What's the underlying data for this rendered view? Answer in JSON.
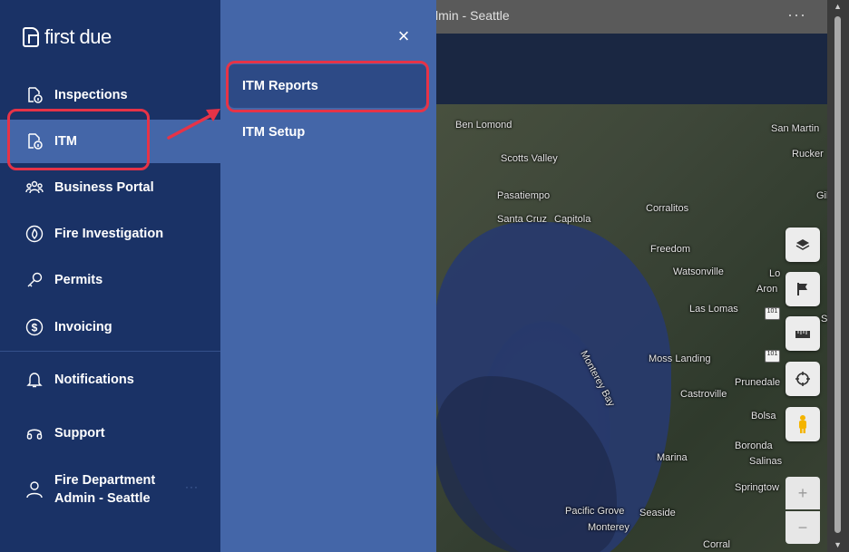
{
  "background_app": {
    "title_fragment": "lmin - Seattle",
    "more_menu": "···"
  },
  "map": {
    "labels": [
      {
        "text": "Ben Lomond"
      },
      {
        "text": "Scotts Valley"
      },
      {
        "text": "Pasatiempo"
      },
      {
        "text": "Santa Cruz"
      },
      {
        "text": "Capitola"
      },
      {
        "text": "Corralitos"
      },
      {
        "text": "Freedom"
      },
      {
        "text": "Watsonville"
      },
      {
        "text": "Las Lomas"
      },
      {
        "text": "Monterey Bay"
      },
      {
        "text": "Moss Landing"
      },
      {
        "text": "Castroville"
      },
      {
        "text": "Prunedale"
      },
      {
        "text": "Bolsa"
      },
      {
        "text": "Boronda"
      },
      {
        "text": "Salinas"
      },
      {
        "text": "Marina"
      },
      {
        "text": "Springtow"
      },
      {
        "text": "Pacific Grove"
      },
      {
        "text": "Seaside"
      },
      {
        "text": "Monterey"
      },
      {
        "text": "Corral"
      },
      {
        "text": "San Martin"
      },
      {
        "text": "Rucker"
      },
      {
        "text": "Gil"
      },
      {
        "text": "Lo"
      },
      {
        "text": "Aron"
      },
      {
        "text": "S"
      }
    ],
    "route_shields": [
      "101",
      "101"
    ],
    "controls": {
      "zoom_in": "+",
      "zoom_out": "−"
    }
  },
  "sidebar": {
    "logo_text": "first due",
    "items": [
      {
        "label": "Inspections"
      },
      {
        "label": "ITM"
      },
      {
        "label": "Business Portal"
      },
      {
        "label": "Fire Investigation"
      },
      {
        "label": "Permits"
      },
      {
        "label": "Invoicing"
      },
      {
        "label": "Notifications"
      },
      {
        "label": "Support"
      }
    ],
    "user": {
      "line1": "Fire Department",
      "line2": "Admin - Seattle",
      "more": "···"
    }
  },
  "submenu": {
    "close": "×",
    "items": [
      {
        "label": "ITM Reports"
      },
      {
        "label": "ITM Setup"
      }
    ]
  },
  "colors": {
    "sidebar_bg": "#1a3266",
    "active_bg": "#4466a8",
    "highlight": "#e63347"
  }
}
